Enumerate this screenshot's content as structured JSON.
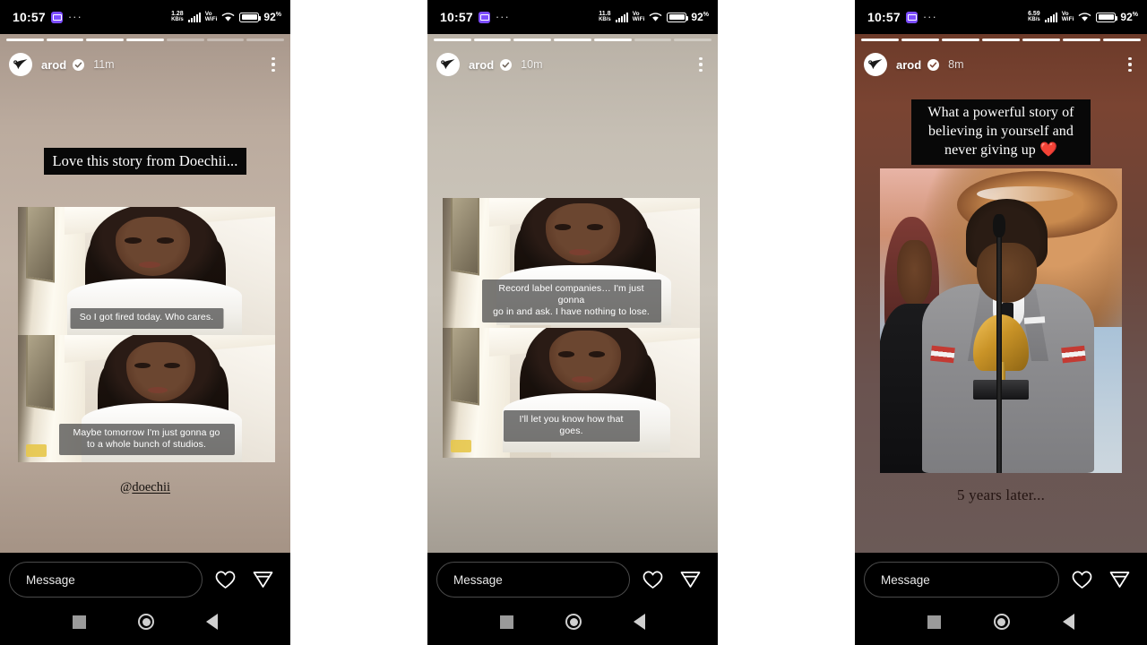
{
  "app": "instagram-stories",
  "status_bar": {
    "time": "10:57",
    "app_icon": "chat-app-icon",
    "overflow": "···",
    "network_speed_1": "1.28",
    "network_speed_2": "11.8",
    "network_speed_3": "6.59",
    "speed_unit": "KB/s",
    "signal": "signal-bars-icon",
    "volte": "Vo",
    "wifi_label": "WiFi",
    "wifi": "wifi-icon",
    "battery": "battery-icon",
    "battery_pct": "92",
    "battery_pct_symbol": "%"
  },
  "bottom_bar": {
    "message_placeholder": "Message",
    "like_icon": "heart-icon",
    "send_icon": "paper-plane-icon"
  },
  "nav_bar": {
    "recents": "square-recents-icon",
    "home": "circle-home-icon",
    "back": "triangle-back-icon"
  },
  "panels": [
    {
      "id": "panel-1",
      "header": {
        "avatar": "arod-avatar-icon",
        "username": "arod",
        "verified": "verified-badge-icon",
        "timestamp": "11m",
        "menu": "more-options-icon"
      },
      "progress": {
        "segments": 7,
        "filled": 4
      },
      "headline": "Love this story from Doechii...",
      "captions": [
        "So I got fired today. Who cares.",
        "Maybe tomorrow I'm just gonna go\nto a whole bunch of studios."
      ],
      "mention_prefix": "@",
      "mention": "doechii",
      "background": "#bbab9e"
    },
    {
      "id": "panel-2",
      "header": {
        "avatar": "arod-avatar-icon",
        "username": "arod",
        "verified": "verified-badge-icon",
        "timestamp": "10m",
        "menu": "more-options-icon"
      },
      "progress": {
        "segments": 7,
        "filled": 5
      },
      "captions": [
        "Record label companies… I'm just gonna\ngo in and ask. I have nothing to lose.",
        "I'll let you know how that goes."
      ],
      "background": "#c6bfb4"
    },
    {
      "id": "panel-3",
      "header": {
        "avatar": "arod-avatar-icon",
        "username": "arod",
        "verified": "verified-badge-icon",
        "timestamp": "8m",
        "menu": "more-options-icon"
      },
      "progress": {
        "segments": 7,
        "filled": 7
      },
      "headline": "What a powerful story of believing in yourself and never giving up ❤️",
      "footer_text": "5 years later...",
      "photo": "grammy-acceptance-photo",
      "background": "#7a4432"
    }
  ],
  "colors": {
    "status_bar_bg": "#000000",
    "bottom_bar_bg": "#000000",
    "headline_bg": "#080808",
    "caption_bg": "rgba(70,70,70,.72)",
    "accent_purple": "#7c4dff"
  }
}
